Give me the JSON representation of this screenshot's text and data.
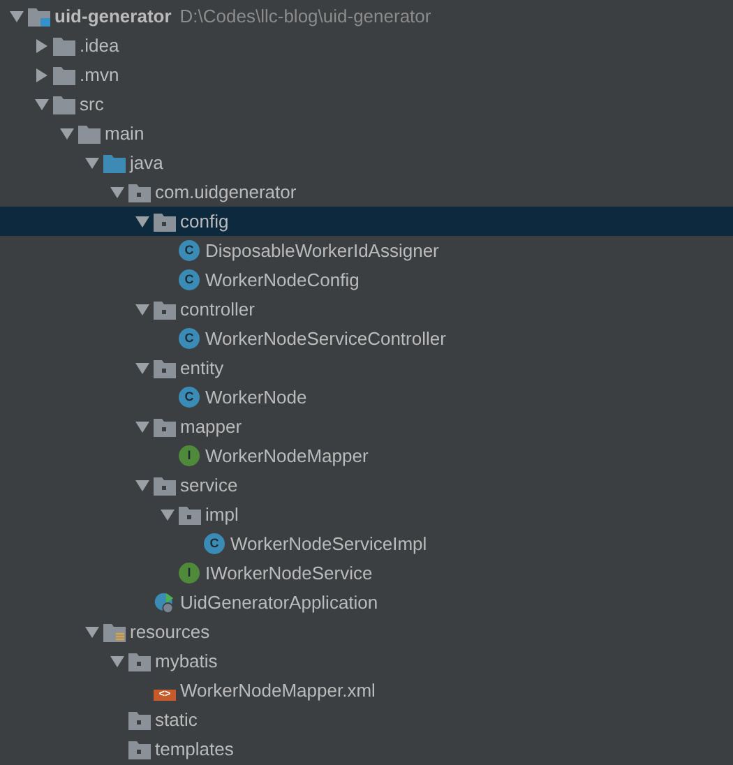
{
  "project_tree": [
    {
      "kind": "project",
      "name": "uid-generator",
      "path": "D:\\Codes\\llc-blog\\uid-generator",
      "expanded": true,
      "selected": false,
      "children": [
        {
          "kind": "folder",
          "name": ".idea",
          "expanded": false,
          "selected": false
        },
        {
          "kind": "folder",
          "name": ".mvn",
          "expanded": false,
          "selected": false
        },
        {
          "kind": "folder",
          "name": "src",
          "expanded": true,
          "selected": false,
          "children": [
            {
              "kind": "folder",
              "name": "main",
              "expanded": true,
              "selected": false,
              "children": [
                {
                  "kind": "source-folder",
                  "name": "java",
                  "expanded": true,
                  "selected": false,
                  "children": [
                    {
                      "kind": "package",
                      "name": "com.uidgenerator",
                      "expanded": true,
                      "selected": false,
                      "children": [
                        {
                          "kind": "package",
                          "name": "config",
                          "expanded": true,
                          "selected": true,
                          "children": [
                            {
                              "kind": "class",
                              "badge": "C",
                              "name": "DisposableWorkerIdAssigner",
                              "selected": false
                            },
                            {
                              "kind": "class",
                              "badge": "C",
                              "name": "WorkerNodeConfig",
                              "selected": false
                            }
                          ]
                        },
                        {
                          "kind": "package",
                          "name": "controller",
                          "expanded": true,
                          "selected": false,
                          "children": [
                            {
                              "kind": "class",
                              "badge": "C",
                              "name": "WorkerNodeServiceController",
                              "selected": false
                            }
                          ]
                        },
                        {
                          "kind": "package",
                          "name": "entity",
                          "expanded": true,
                          "selected": false,
                          "children": [
                            {
                              "kind": "class",
                              "badge": "C",
                              "name": "WorkerNode",
                              "selected": false
                            }
                          ]
                        },
                        {
                          "kind": "package",
                          "name": "mapper",
                          "expanded": true,
                          "selected": false,
                          "children": [
                            {
                              "kind": "interface",
                              "badge": "I",
                              "name": "WorkerNodeMapper",
                              "selected": false
                            }
                          ]
                        },
                        {
                          "kind": "package",
                          "name": "service",
                          "expanded": true,
                          "selected": false,
                          "children": [
                            {
                              "kind": "package",
                              "name": "impl",
                              "expanded": true,
                              "selected": false,
                              "children": [
                                {
                                  "kind": "class",
                                  "badge": "C",
                                  "name": "WorkerNodeServiceImpl",
                                  "selected": false
                                }
                              ]
                            },
                            {
                              "kind": "interface",
                              "badge": "I",
                              "name": "IWorkerNodeService",
                              "selected": false
                            }
                          ]
                        },
                        {
                          "kind": "spring-app",
                          "name": "UidGeneratorApplication",
                          "selected": false
                        }
                      ]
                    }
                  ]
                },
                {
                  "kind": "resources-folder",
                  "name": "resources",
                  "expanded": true,
                  "selected": false,
                  "children": [
                    {
                      "kind": "package",
                      "name": "mybatis",
                      "expanded": true,
                      "selected": false,
                      "children": [
                        {
                          "kind": "xml",
                          "badge": "<>",
                          "name": "WorkerNodeMapper.xml",
                          "selected": false
                        }
                      ]
                    },
                    {
                      "kind": "package",
                      "name": "static",
                      "selected": false
                    },
                    {
                      "kind": "package",
                      "name": "templates",
                      "selected": false
                    }
                  ]
                }
              ]
            }
          ]
        }
      ]
    }
  ]
}
